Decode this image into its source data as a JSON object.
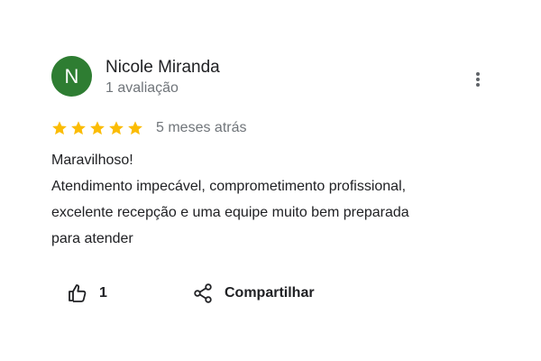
{
  "reviewer": {
    "initial": "N",
    "name": "Nicole Miranda",
    "reviews_count": "1 avaliação",
    "avatar_color": "#2e7d32"
  },
  "rating": {
    "stars": 5,
    "max_stars": 5,
    "star_color": "#fbbc04",
    "date": "5 meses atrás"
  },
  "review": {
    "lines": [
      "Maravilhoso!",
      "Atendimento impecável, comprometimento profissional,",
      "excelente recepção e uma equipe muito bem preparada",
      "para atender"
    ]
  },
  "actions": {
    "like_icon": "thumbs-up-icon",
    "like_count": "1",
    "share_icon": "share-icon",
    "share_label": "Compartilhar"
  },
  "menu": {
    "icon": "more-vertical-icon"
  }
}
